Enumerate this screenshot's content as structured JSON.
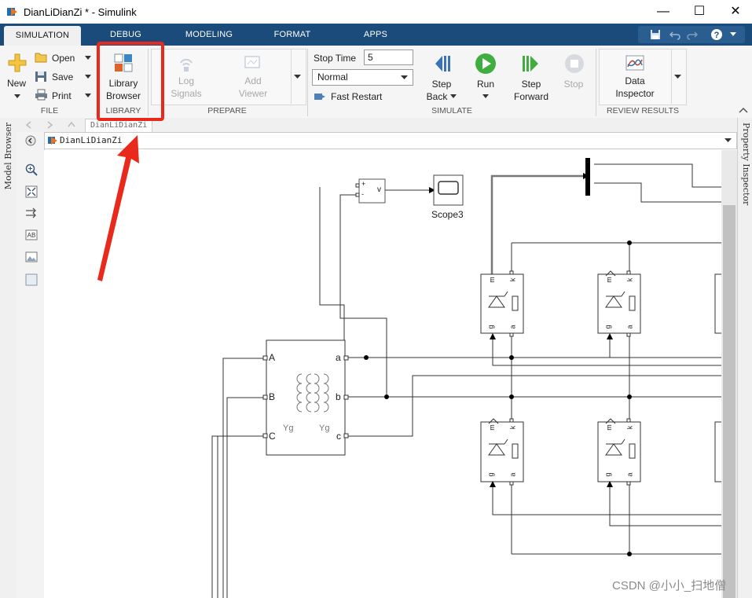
{
  "window": {
    "title": "DianLiDianZi * - Simulink"
  },
  "tabs": [
    {
      "label": "SIMULATION",
      "active": true
    },
    {
      "label": "DEBUG"
    },
    {
      "label": "MODELING"
    },
    {
      "label": "FORMAT"
    },
    {
      "label": "APPS"
    }
  ],
  "ribbon": {
    "file": {
      "new_label": "New",
      "open_label": "Open",
      "save_label": "Save",
      "print_label": "Print",
      "group_label": "FILE"
    },
    "library": {
      "button_line1": "Library",
      "button_line2": "Browser",
      "group_label": "LIBRARY"
    },
    "prepare": {
      "log_line1": "Log",
      "log_line2": "Signals",
      "add_line1": "Add",
      "add_line2": "Viewer",
      "group_label": "PREPARE"
    },
    "simulate": {
      "stop_time_label": "Stop Time",
      "stop_time_value": "5",
      "mode_value": "Normal",
      "fast_restart_label": "Fast Restart",
      "step_back_line1": "Step",
      "step_back_line2": "Back",
      "run_label": "Run",
      "step_forward_line1": "Step",
      "step_forward_line2": "Forward",
      "stop_label": "Stop",
      "group_label": "SIMULATE"
    },
    "review": {
      "data_line1": "Data",
      "data_line2": "Inspector",
      "group_label": "REVIEW RESULTS"
    }
  },
  "side": {
    "model_browser_label": "Model Browser",
    "property_inspector_label": "Property Inspector"
  },
  "breadcrumb": {
    "tab_label": "DianLiDianZi",
    "path_label": "DianLiDianZi"
  },
  "diagram": {
    "scope_label": "Scope3",
    "sum_plus": "+",
    "sum_minus": "-",
    "sum_out": "v",
    "transformer": {
      "port_A": "A",
      "port_B": "B",
      "port_C": "C",
      "port_a": "a",
      "port_b": "b",
      "port_c": "c",
      "winding_left": "Yg",
      "winding_right": "Yg"
    },
    "thyristor_port_m": "m",
    "thyristor_port_k": "k",
    "thyristor_port_g": "g",
    "thyristor_port_a": "a"
  },
  "watermark": "CSDN @小小_扫地僧",
  "colors": {
    "ribbon_tab_bg": "#1b4b7a",
    "annotation_red": "#e8291c",
    "run_green": "#3fae3f"
  }
}
